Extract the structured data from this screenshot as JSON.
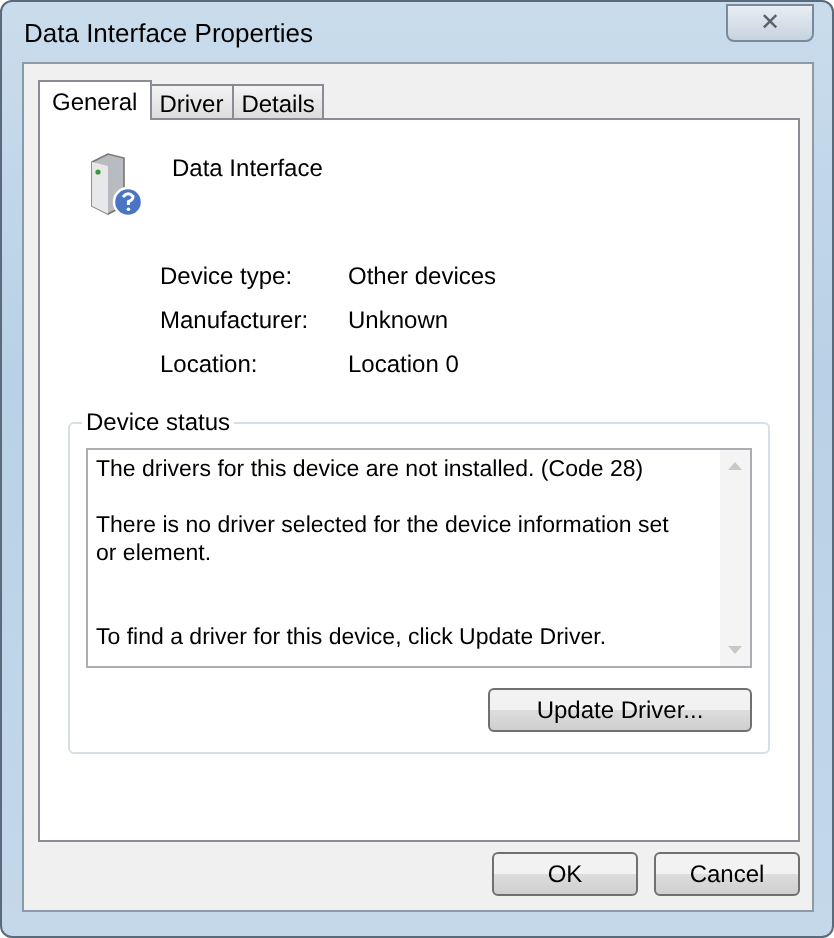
{
  "window": {
    "title": "Data Interface Properties",
    "close_symbol": "✕"
  },
  "tabs": [
    {
      "label": "General",
      "selected": true
    },
    {
      "label": "Driver",
      "selected": false
    },
    {
      "label": "Details",
      "selected": false
    }
  ],
  "device": {
    "name": "Data Interface"
  },
  "properties": [
    {
      "label": "Device type:",
      "value": "Other devices"
    },
    {
      "label": "Manufacturer:",
      "value": "Unknown"
    },
    {
      "label": "Location:",
      "value": "Location 0"
    }
  ],
  "device_status": {
    "title": "Device status",
    "lines": [
      "The drivers for this device are not installed. (Code 28)",
      "There is no driver selected for the device information set or element.",
      "To find a driver for this device, click Update Driver."
    ],
    "button": "Update Driver..."
  },
  "buttons": [
    "OK",
    "Cancel"
  ]
}
